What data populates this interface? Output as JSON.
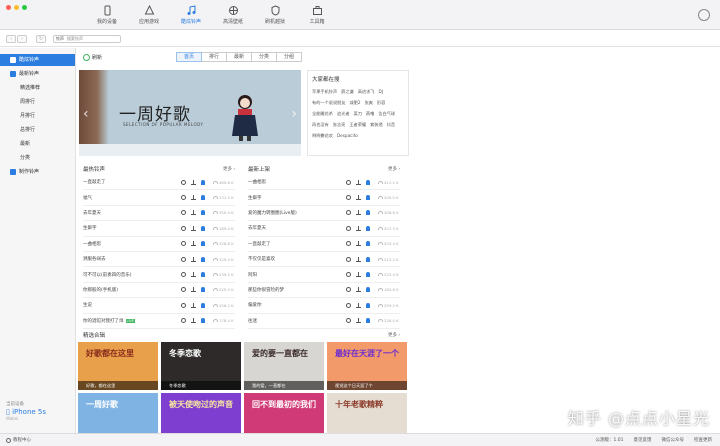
{
  "window": {
    "dot_colors": [
      "#ff5f57",
      "#febc2e",
      "#28c840"
    ]
  },
  "nav": {
    "tabs": [
      {
        "label": "我的设备",
        "icon": "phone-icon"
      },
      {
        "label": "应用游戏",
        "icon": "apps-icon"
      },
      {
        "label": "酷炫铃声",
        "icon": "music-note-icon",
        "active": true
      },
      {
        "label": "高清壁纸",
        "icon": "flower-icon"
      },
      {
        "label": "刷机越狱",
        "icon": "shield-icon"
      },
      {
        "label": "工具箱",
        "icon": "toolbox-icon"
      }
    ]
  },
  "search": {
    "scope": "铃声",
    "placeholder": "搜索铃声"
  },
  "sidebar": {
    "items": [
      {
        "label": "酷炫铃声",
        "type": "group",
        "color": "#e24b4b",
        "active": true
      },
      {
        "label": "最新铃声",
        "type": "group",
        "color": "#2b7de0"
      },
      {
        "label": "精选推荐",
        "type": "child"
      },
      {
        "label": "周排行",
        "type": "child"
      },
      {
        "label": "月排行",
        "type": "child"
      },
      {
        "label": "总排行",
        "type": "child"
      },
      {
        "label": "最新",
        "type": "child"
      },
      {
        "label": "分类",
        "type": "child"
      },
      {
        "label": "制作铃声",
        "type": "group",
        "color": "#2b7de0"
      }
    ],
    "device": {
      "label": "当前设备",
      "name": "iPhone 5s",
      "status": "Wabei"
    }
  },
  "main": {
    "refresh": "刷新",
    "tabs": [
      "首页",
      "排行",
      "最新",
      "分类",
      "分组"
    ],
    "banner": {
      "title": "一周好歌",
      "subtitle": "SELECTION OF POPULAR MELODY"
    },
    "hot_search": {
      "title": "大家都在搜",
      "words": [
        "苹果手机铃声",
        "薛之谦",
        "高进求飞",
        "DJ",
        "有的一个说说朋友",
        "减肥2",
        "张爽",
        "形容",
        "全能雕花杀",
        "追光者",
        "菜刀",
        "燕噜",
        "告白气球",
        "再也没有",
        "张志亮",
        "王者荣耀",
        "紫装透",
        "抖音",
        "咧咧撒花欢",
        "Despacito"
      ]
    },
    "hot_ringtones": {
      "title": "最热铃声",
      "more": "更多 ›",
      "songs": [
        {
          "name": "一直敲走了",
          "size": "469.8 K"
        },
        {
          "name": "福气",
          "size": "231.5 K"
        },
        {
          "name": "去年夏天",
          "size": "350.4 K"
        },
        {
          "name": "生僻字",
          "size": "189.4 K"
        },
        {
          "name": "一曲相思",
          "size": "328.8 K"
        },
        {
          "name": "溯服各阔去",
          "size": "129.4 K"
        },
        {
          "name": "可不可以(前奏四的音乐)",
          "size": "239.2 K"
        },
        {
          "name": "你那般的(手机版)",
          "size": "225.3 K"
        },
        {
          "name": "生说",
          "size": "256.2 K"
        },
        {
          "name": "你的酒馆对我打了烊",
          "size": "178.4 K",
          "badge": "LIVE"
        }
      ]
    },
    "newest": {
      "title": "最新上架",
      "more": "更多 ›",
      "songs": [
        {
          "name": "一曲相思",
          "size": "412.2 K"
        },
        {
          "name": "生僻字",
          "size": "209.0 K"
        },
        {
          "name": "爱的魔力转圈圈(Live版)",
          "size": "306.8 K"
        },
        {
          "name": "去年夏天",
          "size": "207.3 K"
        },
        {
          "name": "一直敲走了",
          "size": "203.4 K"
        },
        {
          "name": "不仅仅是喜欢",
          "size": "213.2 K"
        },
        {
          "name": "阿阳",
          "size": "225.4 K"
        },
        {
          "name": "那些你很冒险的梦",
          "size": "183.6 K"
        },
        {
          "name": "偏爱你",
          "size": "259.2 K"
        },
        {
          "name": "往迷",
          "size": "228.0 K"
        }
      ]
    },
    "collections": {
      "title": "精选合辑",
      "more": "更多 ›",
      "items": [
        {
          "big": "好歌都在这里",
          "caption": "好歌，都在这里",
          "bg": "#e9a04b",
          "fg": "#8a2c1c"
        },
        {
          "big": "冬季恋歌",
          "caption": "冬季恋歌",
          "bg": "#2e2a2a",
          "fg": "#ffffff"
        },
        {
          "big": "爱的要一直都在",
          "caption": "我的爱，一直都在",
          "bg": "#d8d6d2",
          "fg": "#3a2a2a"
        },
        {
          "big": "最好在天涯了一个",
          "caption": "视觉这个日天涯了个",
          "bg": "#f39a6b",
          "fg": "#6a2bd0"
        },
        {
          "big": "一周好歌",
          "caption": "",
          "bg": "#7fb3e3",
          "fg": "#ffffff"
        },
        {
          "big": "被天使吻过的声音",
          "caption": "",
          "bg": "#7e3fd0",
          "fg": "#f7e7a0"
        },
        {
          "big": "回不到最初的我们",
          "caption": "",
          "bg": "#d03a76",
          "fg": "#ffffff"
        },
        {
          "big": "十年老歌精粹",
          "caption": "",
          "bg": "#e6ddd2",
          "fg": "#8a3a2a"
        }
      ]
    }
  },
  "statusbar": {
    "left": "教程中心",
    "items": [
      "公测版：1.01",
      "意见反馈",
      "微信公众号",
      "检查更新"
    ]
  },
  "watermark": "知乎 @点点小星光"
}
